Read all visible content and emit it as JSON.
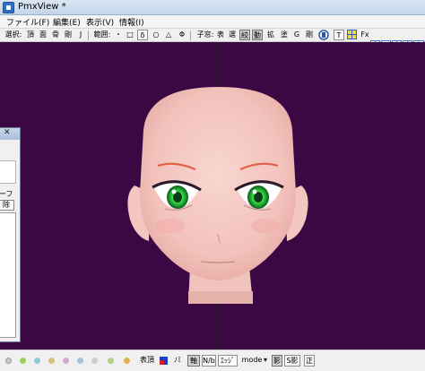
{
  "window": {
    "title": "PmxView *"
  },
  "menu": {
    "file": "ファイル(F)",
    "edit": "編集(E)",
    "view": "表示(V)",
    "info": "情報(I)"
  },
  "toolbar": {
    "select_label": "選択:",
    "vertex": "頂",
    "face": "面",
    "bone": "骨",
    "rigid": "剛",
    "joint": "J",
    "range_label": "範囲:",
    "dot": "・",
    "square": "□",
    "delta": "δ",
    "circle": "○",
    "triangle": "△",
    "phi": "Φ",
    "subform_label": "子窓:",
    "table": "表",
    "select": "選",
    "twist": "絞",
    "move": "動",
    "expand": "拡",
    "paint": "塗",
    "g": "G",
    "strong": "剛",
    "t": "T",
    "fx": "Fx"
  },
  "side_panel": {
    "label": "ーフ",
    "button": "除"
  },
  "statusbar": {
    "show_top": "表頂",
    "mi": "ﾉﾐ",
    "axis": "軸",
    "nrm": "N/b",
    "edge": "ｴｯｼﾞ",
    "mode": "mode",
    "mode_arrow": "▾",
    "shadow": "影",
    "self_shadow": "S影",
    "correct": "正"
  },
  "colors": {
    "viewport_bg": "#3b0843",
    "accent": "#3978c8"
  },
  "icons": [
    "app-icon",
    "close-icon",
    "move-arrows-icon",
    "rotate-icon",
    "zoom-icon",
    "camera-icon",
    "grid-icon",
    "shield-icon",
    "color-swatch-icon"
  ]
}
